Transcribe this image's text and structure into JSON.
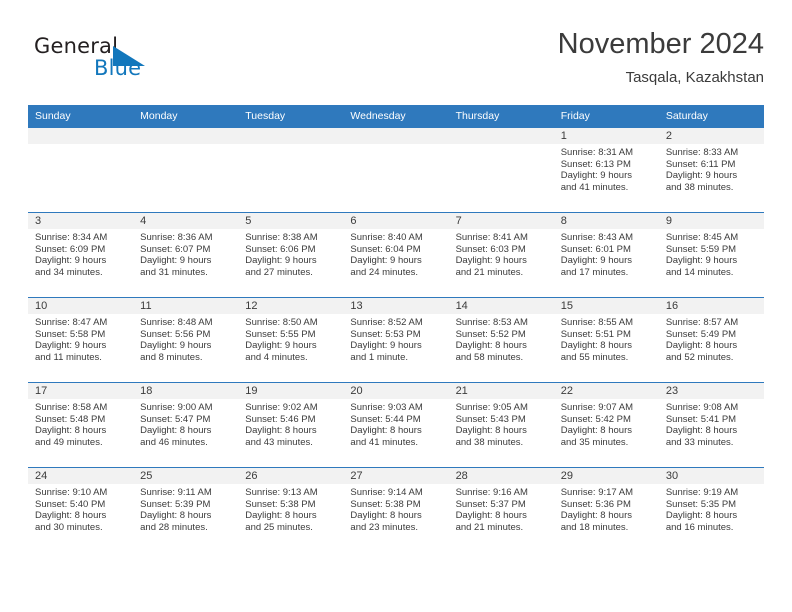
{
  "brand": {
    "name_top": "General",
    "name_bottom": "Blue",
    "triangle_icon": "brand-triangle-icon",
    "color_blue": "#1277bc",
    "color_dark": "#231f20"
  },
  "header": {
    "title": "November 2024",
    "subtitle": "Tasqala, Kazakhstan"
  },
  "theme": {
    "header_bg": "#2f79bd",
    "header_text": "#ffffff",
    "daynum_bg": "#f2f2f2",
    "body_text": "#3b3b3b",
    "grid_line": "#2f79bd"
  },
  "calendar": {
    "weekday_headers": [
      "Sunday",
      "Monday",
      "Tuesday",
      "Wednesday",
      "Thursday",
      "Friday",
      "Saturday"
    ],
    "weeks": [
      [
        {
          "day": "",
          "lines": []
        },
        {
          "day": "",
          "lines": []
        },
        {
          "day": "",
          "lines": []
        },
        {
          "day": "",
          "lines": []
        },
        {
          "day": "",
          "lines": []
        },
        {
          "day": "1",
          "lines": [
            "Sunrise: 8:31 AM",
            "Sunset: 6:13 PM",
            "Daylight: 9 hours",
            "and 41 minutes."
          ]
        },
        {
          "day": "2",
          "lines": [
            "Sunrise: 8:33 AM",
            "Sunset: 6:11 PM",
            "Daylight: 9 hours",
            "and 38 minutes."
          ]
        }
      ],
      [
        {
          "day": "3",
          "lines": [
            "Sunrise: 8:34 AM",
            "Sunset: 6:09 PM",
            "Daylight: 9 hours",
            "and 34 minutes."
          ]
        },
        {
          "day": "4",
          "lines": [
            "Sunrise: 8:36 AM",
            "Sunset: 6:07 PM",
            "Daylight: 9 hours",
            "and 31 minutes."
          ]
        },
        {
          "day": "5",
          "lines": [
            "Sunrise: 8:38 AM",
            "Sunset: 6:06 PM",
            "Daylight: 9 hours",
            "and 27 minutes."
          ]
        },
        {
          "day": "6",
          "lines": [
            "Sunrise: 8:40 AM",
            "Sunset: 6:04 PM",
            "Daylight: 9 hours",
            "and 24 minutes."
          ]
        },
        {
          "day": "7",
          "lines": [
            "Sunrise: 8:41 AM",
            "Sunset: 6:03 PM",
            "Daylight: 9 hours",
            "and 21 minutes."
          ]
        },
        {
          "day": "8",
          "lines": [
            "Sunrise: 8:43 AM",
            "Sunset: 6:01 PM",
            "Daylight: 9 hours",
            "and 17 minutes."
          ]
        },
        {
          "day": "9",
          "lines": [
            "Sunrise: 8:45 AM",
            "Sunset: 5:59 PM",
            "Daylight: 9 hours",
            "and 14 minutes."
          ]
        }
      ],
      [
        {
          "day": "10",
          "lines": [
            "Sunrise: 8:47 AM",
            "Sunset: 5:58 PM",
            "Daylight: 9 hours",
            "and 11 minutes."
          ]
        },
        {
          "day": "11",
          "lines": [
            "Sunrise: 8:48 AM",
            "Sunset: 5:56 PM",
            "Daylight: 9 hours",
            "and 8 minutes."
          ]
        },
        {
          "day": "12",
          "lines": [
            "Sunrise: 8:50 AM",
            "Sunset: 5:55 PM",
            "Daylight: 9 hours",
            "and 4 minutes."
          ]
        },
        {
          "day": "13",
          "lines": [
            "Sunrise: 8:52 AM",
            "Sunset: 5:53 PM",
            "Daylight: 9 hours",
            "and 1 minute."
          ]
        },
        {
          "day": "14",
          "lines": [
            "Sunrise: 8:53 AM",
            "Sunset: 5:52 PM",
            "Daylight: 8 hours",
            "and 58 minutes."
          ]
        },
        {
          "day": "15",
          "lines": [
            "Sunrise: 8:55 AM",
            "Sunset: 5:51 PM",
            "Daylight: 8 hours",
            "and 55 minutes."
          ]
        },
        {
          "day": "16",
          "lines": [
            "Sunrise: 8:57 AM",
            "Sunset: 5:49 PM",
            "Daylight: 8 hours",
            "and 52 minutes."
          ]
        }
      ],
      [
        {
          "day": "17",
          "lines": [
            "Sunrise: 8:58 AM",
            "Sunset: 5:48 PM",
            "Daylight: 8 hours",
            "and 49 minutes."
          ]
        },
        {
          "day": "18",
          "lines": [
            "Sunrise: 9:00 AM",
            "Sunset: 5:47 PM",
            "Daylight: 8 hours",
            "and 46 minutes."
          ]
        },
        {
          "day": "19",
          "lines": [
            "Sunrise: 9:02 AM",
            "Sunset: 5:46 PM",
            "Daylight: 8 hours",
            "and 43 minutes."
          ]
        },
        {
          "day": "20",
          "lines": [
            "Sunrise: 9:03 AM",
            "Sunset: 5:44 PM",
            "Daylight: 8 hours",
            "and 41 minutes."
          ]
        },
        {
          "day": "21",
          "lines": [
            "Sunrise: 9:05 AM",
            "Sunset: 5:43 PM",
            "Daylight: 8 hours",
            "and 38 minutes."
          ]
        },
        {
          "day": "22",
          "lines": [
            "Sunrise: 9:07 AM",
            "Sunset: 5:42 PM",
            "Daylight: 8 hours",
            "and 35 minutes."
          ]
        },
        {
          "day": "23",
          "lines": [
            "Sunrise: 9:08 AM",
            "Sunset: 5:41 PM",
            "Daylight: 8 hours",
            "and 33 minutes."
          ]
        }
      ],
      [
        {
          "day": "24",
          "lines": [
            "Sunrise: 9:10 AM",
            "Sunset: 5:40 PM",
            "Daylight: 8 hours",
            "and 30 minutes."
          ]
        },
        {
          "day": "25",
          "lines": [
            "Sunrise: 9:11 AM",
            "Sunset: 5:39 PM",
            "Daylight: 8 hours",
            "and 28 minutes."
          ]
        },
        {
          "day": "26",
          "lines": [
            "Sunrise: 9:13 AM",
            "Sunset: 5:38 PM",
            "Daylight: 8 hours",
            "and 25 minutes."
          ]
        },
        {
          "day": "27",
          "lines": [
            "Sunrise: 9:14 AM",
            "Sunset: 5:38 PM",
            "Daylight: 8 hours",
            "and 23 minutes."
          ]
        },
        {
          "day": "28",
          "lines": [
            "Sunrise: 9:16 AM",
            "Sunset: 5:37 PM",
            "Daylight: 8 hours",
            "and 21 minutes."
          ]
        },
        {
          "day": "29",
          "lines": [
            "Sunrise: 9:17 AM",
            "Sunset: 5:36 PM",
            "Daylight: 8 hours",
            "and 18 minutes."
          ]
        },
        {
          "day": "30",
          "lines": [
            "Sunrise: 9:19 AM",
            "Sunset: 5:35 PM",
            "Daylight: 8 hours",
            "and 16 minutes."
          ]
        }
      ]
    ]
  }
}
